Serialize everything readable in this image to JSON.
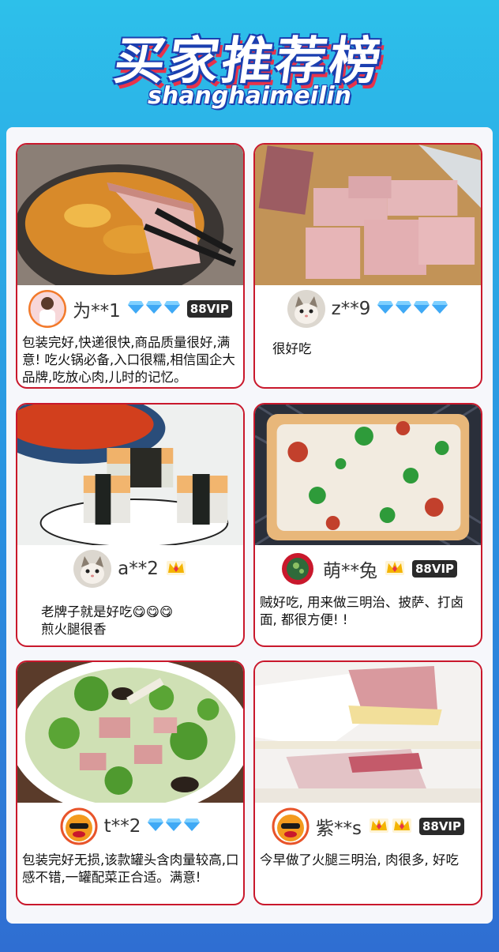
{
  "header": {
    "title": "买家推荐榜",
    "subtitle": "shanghaimeilin"
  },
  "reviews": [
    {
      "user": "为**1",
      "level_icon": "diamond",
      "level_count": 3,
      "vip": "88VIP",
      "avatar_icon": "person-avatar-icon",
      "text": "包装完好,快递很快,商品质量很好,满意! 吃火锅必备,入口很糯,相信国企大品牌,吃放心肉,儿时的记忆。",
      "photo_icon": "hotpot-luncheon-meat-photo"
    },
    {
      "user": "z**9",
      "level_icon": "diamond",
      "level_count": 4,
      "vip": "",
      "avatar_icon": "cat-avatar-icon",
      "text": "很好吃",
      "photo_icon": "sliced-ham-photo"
    },
    {
      "user": "a**2",
      "level_icon": "crown",
      "level_count": 1,
      "vip": "",
      "avatar_icon": "cat-avatar-icon",
      "text": "老牌子就是好吃😋😋😋\n煎火腿很香",
      "photo_icon": "spam-musubi-photo"
    },
    {
      "user": "萌**兔",
      "level_icon": "crown",
      "level_count": 1,
      "vip": "88VIP",
      "avatar_icon": "badge-avatar-icon",
      "text": "贼好吃, 用来做三明治、披萨、打卤面, 都很方便! !",
      "photo_icon": "pizza-photo"
    },
    {
      "user": "t**2",
      "level_icon": "diamond",
      "level_count": 3,
      "vip": "",
      "avatar_icon": "duck-avatar-icon",
      "text": "包装完好无损,该款罐头含肉量较高,口感不错,一罐配菜正合适。满意!",
      "photo_icon": "stir-fry-photo"
    },
    {
      "user": "紫**s",
      "level_icon": "crown",
      "level_count": 2,
      "vip": "88VIP",
      "avatar_icon": "duck-avatar-icon",
      "text": "今早做了火腿三明治, 肉很多, 好吃",
      "photo_icon": "sandwich-photo"
    }
  ],
  "colors": {
    "card_border": "#c9182c",
    "diamond": "#3fa9f5",
    "crown": "#f4b400",
    "vip_bg": "#2a2a2a"
  }
}
